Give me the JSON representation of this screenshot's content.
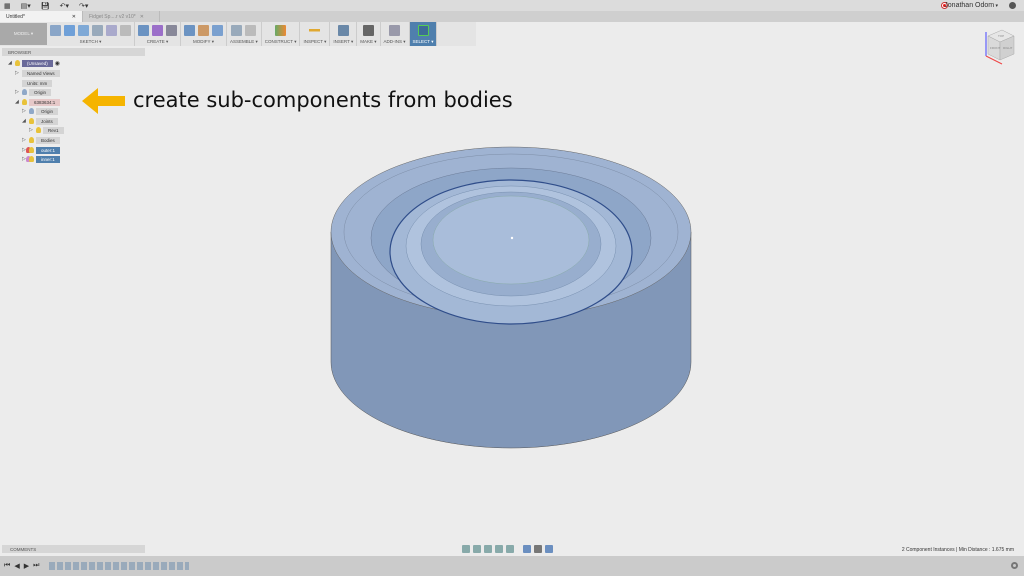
{
  "app": {
    "user": "Jonathan Odom"
  },
  "tabs": [
    {
      "label": "Untitled*",
      "active": true
    },
    {
      "label": "Fidget Sp....r v2 v10*",
      "active": false
    }
  ],
  "toolbar": {
    "model": "MODEL ▾",
    "groups": [
      "SKETCH ▾",
      "CREATE ▾",
      "MODIFY ▾",
      "ASSEMBLE ▾",
      "CONSTRUCT ▾",
      "INSPECT ▾",
      "INSERT ▾",
      "MAKE ▾",
      "ADD-INS ▾",
      "SELECT ▾"
    ]
  },
  "browser": {
    "title": "BROWSER",
    "items": [
      "(Unsaved)",
      "Named Views",
      "Units: mm",
      "Origin",
      "6383634:1",
      "Origin",
      "Joints",
      "Rev1",
      "Bodies",
      "outer:1",
      "inner:1"
    ]
  },
  "annotation": "create sub-components from bodies",
  "comments": "COMMENTS",
  "status": "2 Component Instances | Min Distance : 1.675 mm",
  "viewcube": {
    "top": "TOP",
    "front": "FRONT",
    "right": "RIGHT"
  },
  "colors": {
    "model": "#8ea4c4",
    "accent": "#4f7fad",
    "arrow": "#f5b400"
  }
}
